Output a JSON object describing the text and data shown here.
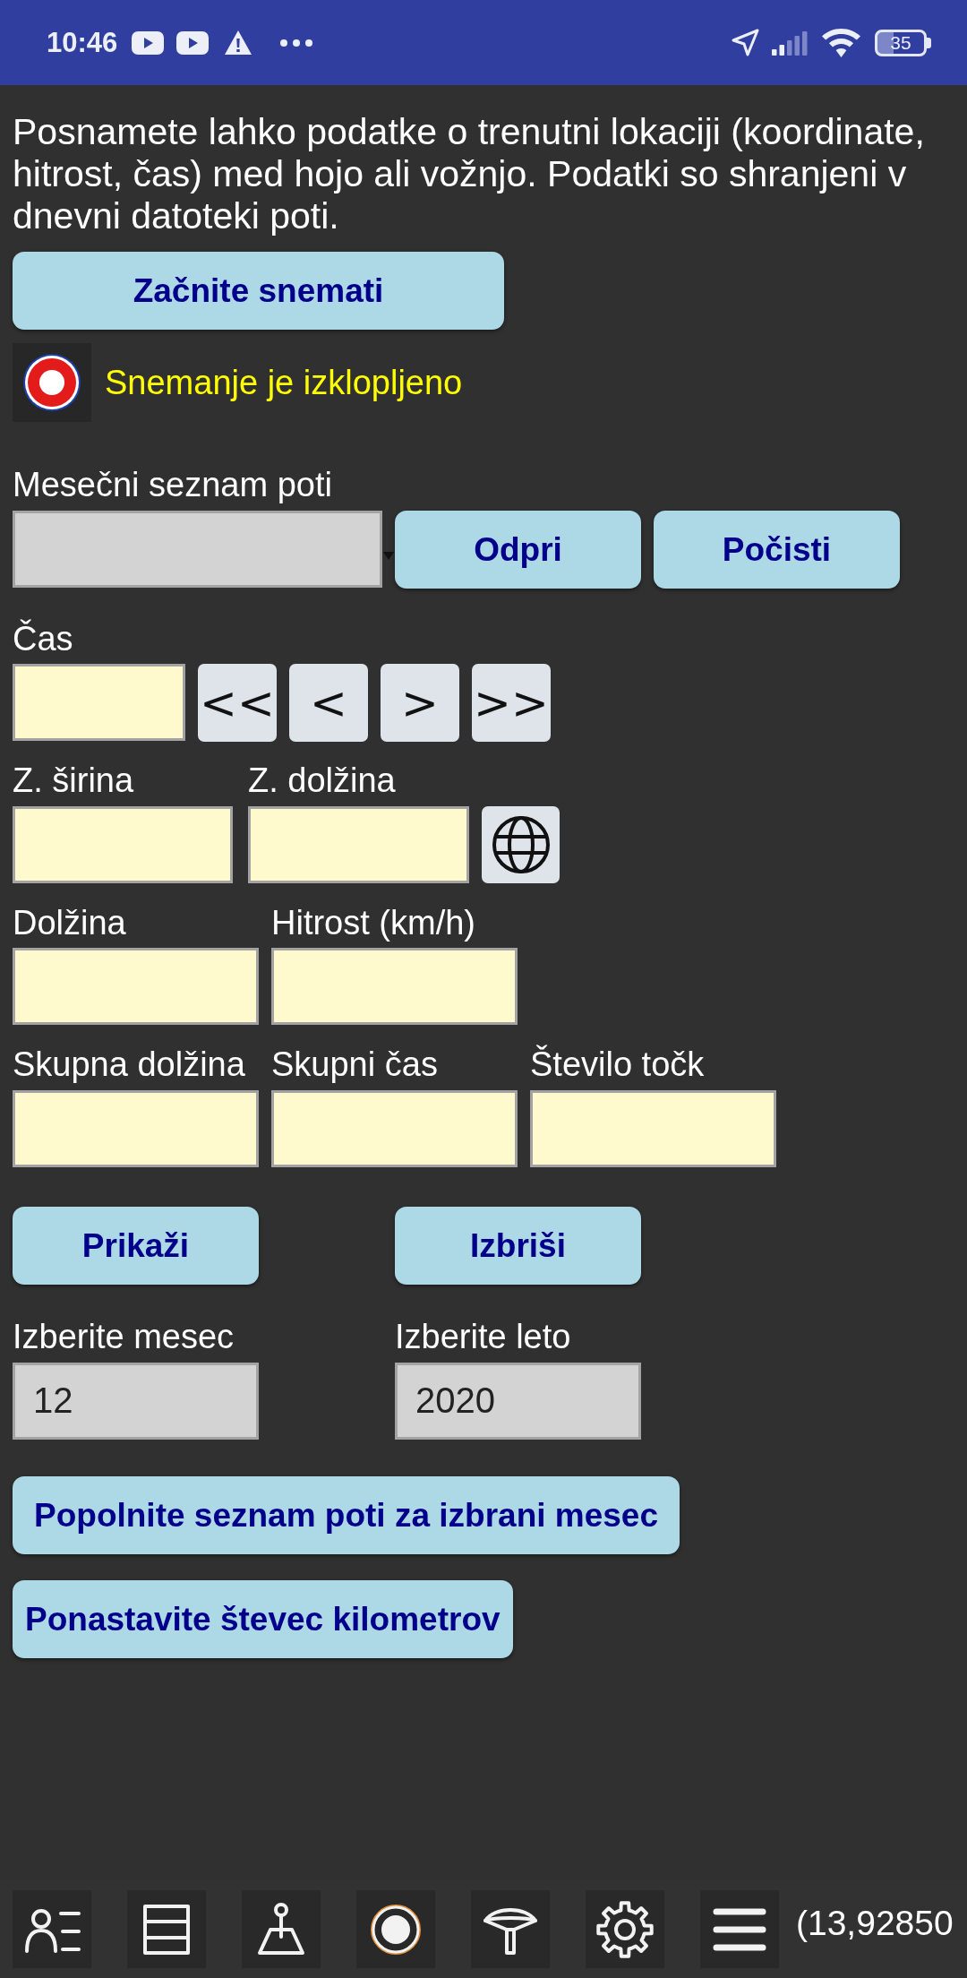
{
  "status_bar": {
    "time": "10:46",
    "battery": "35"
  },
  "intro": "Posnamete lahko podatke o trenutni lokaciji (koordinate, hitrost, čas) med hojo ali vožnjo. Podatki so shranjeni v dnevni datoteki poti.",
  "start_button": "Začnite snemati",
  "recording": {
    "on": false,
    "label": "Snemanje je izklopljeno"
  },
  "route_list": {
    "label": "Mesečni seznam poti",
    "buttons": [
      "Odpri",
      "Počisti"
    ]
  },
  "time": {
    "label": "Čas",
    "nav_buttons": [
      "<<",
      "<",
      ">",
      ">>"
    ]
  },
  "coordinates": [
    {
      "label": "Z. širina"
    },
    {
      "label": "Z. dolžina"
    }
  ],
  "motion": [
    {
      "label": "Dolžina"
    },
    {
      "label": "Hitrost (km/h)"
    }
  ],
  "totals": [
    {
      "label": "Skupna dolžina"
    },
    {
      "label": "Skupni čas"
    },
    {
      "label": "Število točk"
    }
  ],
  "actions": [
    "Prikaži",
    "Izbriši"
  ],
  "period": [
    {
      "label": "Izberite mesec",
      "value": "12"
    },
    {
      "label": "Izberite leto",
      "value": "2020"
    }
  ],
  "fill_button": "Popolnite seznam poti za izbrani mesec",
  "reset_button": "Ponastavite števec kilometrov",
  "bottom_bar": {
    "coordinates": "(13,92850"
  }
}
